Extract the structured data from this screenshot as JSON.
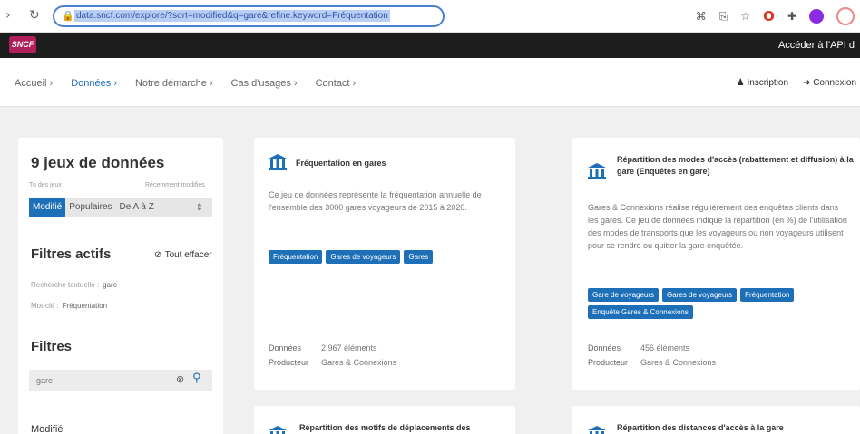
{
  "browser": {
    "url": "data.sncf.com/explore/?sort=modified&q=gare&refine.keyword=Fréquentation"
  },
  "header": {
    "logo_text": "SNCF",
    "api_link": "Accéder à l'API d"
  },
  "nav": {
    "items": [
      {
        "label": "Accueil  ›"
      },
      {
        "label": "Données  ›"
      },
      {
        "label": "Notre démarche  ›"
      },
      {
        "label": "Cas d'usages  ›"
      },
      {
        "label": "Contact  ›"
      }
    ],
    "signup": "Inscription",
    "login": "Connexion"
  },
  "sidebar": {
    "count_title": "9 jeux de données",
    "sort_label": "Tri des jeux",
    "sort_label_right": "Récemment modifiés",
    "sort_options": [
      "Modifié",
      "Populaires",
      "De A à Z"
    ],
    "sort_arrow": "⇕",
    "active_filters_title": "Filtres actifs",
    "clear_all": "Tout effacer",
    "active_filters": [
      {
        "key": "Recherche textuelle :",
        "value": "gare"
      },
      {
        "key": "Mot-clé :",
        "value": "Fréquentation"
      }
    ],
    "filters_title": "Filtres",
    "search_value": "gare",
    "facet_title": "Modifié"
  },
  "cards": [
    {
      "title": "Fréquentation en gares",
      "description": "Ce jeu de données représente la fréquentation annuelle de l'ensemble des 3000 gares voyageurs de 2015 à 2020.",
      "tags": [
        "Fréquentation",
        "Gares de voyageurs",
        "Gares"
      ],
      "data_label": "Données",
      "data_value": "2 967 éléments",
      "producer_label": "Producteur",
      "producer_value": "Gares & Connexions"
    },
    {
      "title": "Répartition des modes d'accès (rabattement et diffusion) à la gare (Enquêtes en gare)",
      "description": "Gares & Connexions réalise régulièrement des enquêtes clients dans les gares. Ce jeu de données indique la répartition (en %) de l'utilisation des modes de transports que les voyageurs ou non voyageurs utilisent pour se rendre ou quitter la gare enquêtée.",
      "tags": [
        "Gare de voyageurs",
        "Gares de voyageurs",
        "Fréquentation",
        "Enquête Gares & Connexions"
      ],
      "data_label": "Données",
      "data_value": "456 éléments",
      "producer_label": "Producteur",
      "producer_value": "Gares & Connexions"
    },
    {
      "title": "Répartition des motifs de déplacements des"
    },
    {
      "title": "Répartition des distances d'accès à la gare"
    }
  ]
}
